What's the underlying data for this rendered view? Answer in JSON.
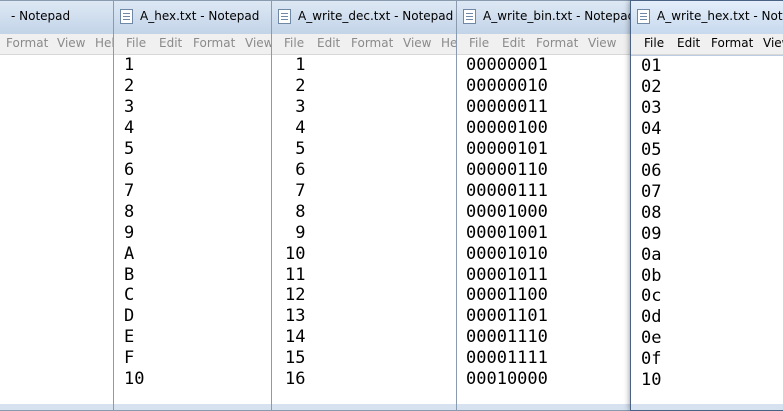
{
  "windows": [
    {
      "title": "- Notepad",
      "menu": [
        "Format",
        "View",
        "Hel"
      ],
      "lines": []
    },
    {
      "title": "A_hex.txt - Notepad",
      "menu": [
        "File",
        "Edit",
        "Format",
        "View"
      ],
      "lines": [
        "1",
        "2",
        "3",
        "4",
        "5",
        "6",
        "7",
        "8",
        "9",
        "A",
        "B",
        "C",
        "D",
        "E",
        "F",
        "10"
      ]
    },
    {
      "title": "A_write_dec.txt - Notepad",
      "menu": [
        "File",
        "Edit",
        "Format",
        "View",
        "He"
      ],
      "lines": [
        " 1",
        " 2",
        " 3",
        " 4",
        " 5",
        " 6",
        " 7",
        " 8",
        " 9",
        "10",
        "11",
        "12",
        "13",
        "14",
        "15",
        "16"
      ]
    },
    {
      "title": "A_write_bin.txt - Notepad",
      "menu": [
        "File",
        "Edit",
        "Format",
        "View"
      ],
      "lines": [
        "00000001",
        "00000010",
        "00000011",
        "00000100",
        "00000101",
        "00000110",
        "00000111",
        "00001000",
        "00001001",
        "00001010",
        "00001011",
        "00001100",
        "00001101",
        "00001110",
        "00001111",
        "00010000"
      ]
    },
    {
      "title": "A_write_hex.txt - Notep",
      "menu": [
        "File",
        "Edit",
        "Format",
        "View"
      ],
      "lines": [
        "01",
        "02",
        "03",
        "04",
        "05",
        "06",
        "07",
        "08",
        "09",
        "0a",
        "0b",
        "0c",
        "0d",
        "0e",
        "0f",
        "10"
      ]
    }
  ],
  "icons": [
    "notepad-icon"
  ],
  "colors": {
    "titlebar": "#c8d9ee",
    "text": "#000000",
    "inactive_menu": "#8a8a8a"
  }
}
